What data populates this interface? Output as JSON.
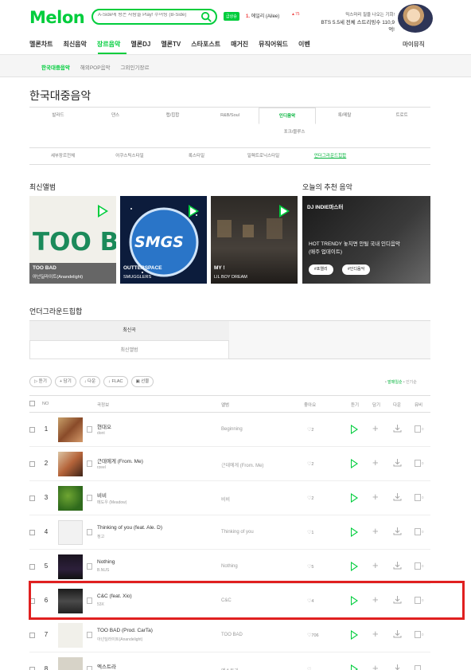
{
  "header": {
    "logo": "Melon",
    "search_placeholder": "A-Side에 평온 사람들 Play! 수어링 (B-Side)",
    "rise_badge": "급상승",
    "rise_rank": "1.",
    "rise_keyword": "에일리 (Ailee)",
    "rise_arrow": "▲75",
    "promo_line1": "믹스마리 질을 나오는 기회!",
    "promo_line2": "BTS 5.5세 전체 스트리밍수 110,9억!"
  },
  "gnb": {
    "items": [
      "멜론차트",
      "최신음악",
      "장르음악",
      "멜론DJ",
      "멜론TV",
      "스타포스트",
      "매거진",
      "뮤직어워드",
      "이벤"
    ],
    "mymusic": "마이뮤직"
  },
  "subnav": [
    "한국대중음악",
    "해외POP음악",
    "그외인기장르"
  ],
  "page_title": "한국대중음악",
  "genres_row1": [
    "발라드",
    "댄스",
    "랩/힙합",
    "R&B/Soul",
    "인디음악",
    "록/메탈",
    "트로트"
  ],
  "genres_row2": [
    "포크/블루스"
  ],
  "genres_sub": [
    "세부장르전체",
    "어쿠스틱스타일",
    "록스타일",
    "일렉트로닉스타일",
    "언더그라운드힙합"
  ],
  "new_albums": {
    "title": "최신앨범",
    "items": [
      {
        "name": "TOO BAD",
        "artist": "아넌딜라이트(Anandelight)"
      },
      {
        "name": "OUTTERSPACE",
        "artist": "SMUGGLERS"
      },
      {
        "name": "MY !",
        "artist": "LIL BOY DREAM"
      }
    ]
  },
  "reco": {
    "title": "오늘의 추천 음악",
    "dj": "DJ INDIE마스터",
    "headline": "HOT TRENDY 놓치면 안될 국내 인디음악 (매주 업데이트)",
    "tag1": "#포엘리",
    "tag2": "#인디음악"
  },
  "underground": {
    "title": "언더그라운드힙합",
    "tab_on": "최신곡",
    "tab_off": "최신앨범"
  },
  "toolbar": [
    "듣기",
    "담기",
    "다운",
    "FLAC",
    "선물"
  ],
  "sort": {
    "active": "발매일순",
    "other": "인기순"
  },
  "columns": {
    "no": "NO",
    "song": "곡정보",
    "album": "앨범",
    "like": "좋아요",
    "listen": "듣기",
    "add": "담기",
    "down": "다운",
    "mv": "뮤비"
  },
  "rows": [
    {
      "rank": "1",
      "title": "현대오",
      "artist": "dont",
      "album": "Beginning",
      "likes": "2",
      "mv": "0"
    },
    {
      "rank": "2",
      "title": "근데에게 (From. Me)",
      "artist": "rzeel",
      "album": "근데에게 (From. Me)",
      "likes": "2",
      "mv": "0"
    },
    {
      "rank": "3",
      "title": "비비",
      "artist": "메도우 (Meadow)",
      "album": "비비",
      "likes": "2",
      "mv": "0"
    },
    {
      "rank": "4",
      "title": "Thinking of you (feat. Ale. D)",
      "artist": "정고",
      "album": "Thinking of you",
      "likes": "1",
      "mv": "0"
    },
    {
      "rank": "5",
      "title": "Nothing",
      "artist": "B.NUS",
      "album": "Nothing",
      "likes": "5",
      "mv": "0"
    },
    {
      "rank": "6",
      "title": "C&C (feat. Xio)",
      "artist": "53X",
      "album": "C&C",
      "likes": "4",
      "mv": "0"
    },
    {
      "rank": "7",
      "title": "TOO BAD (Prod. CarTa)",
      "artist": "아넌딜라이트(Anandelight)",
      "album": "TOO BAD",
      "likes": "706",
      "mv": "0"
    },
    {
      "rank": "8",
      "title": "엑스트라",
      "artist": "",
      "album": "엑스트라",
      "likes": "",
      "mv": ""
    }
  ],
  "colors": {
    "brand": "#00cd3c",
    "highlight": "#e02020"
  }
}
